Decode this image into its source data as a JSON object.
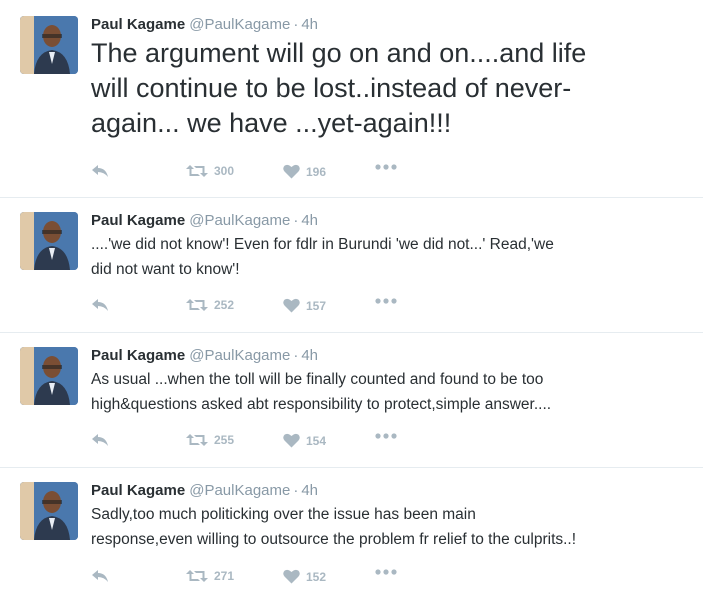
{
  "author": {
    "name": "Paul Kagame",
    "handle": "@PaulKagame",
    "separator": "·"
  },
  "colors": {
    "text": "#292f33",
    "muted": "#8899a6",
    "action": "#aab8c2",
    "divider": "#e6ecf0"
  },
  "tweets": [
    {
      "time": "4h",
      "text_lines": [
        "The argument will go on and on....and life",
        "will continue to be lost..instead of never-",
        "again... we have ...yet-again!!!"
      ],
      "retweets": "300",
      "likes": "196"
    },
    {
      "time": "4h",
      "text_lines": [
        "....'we did not know'!  Even for fdlr in Burundi 'we did not...'  Read,'we",
        "did not want to know'!"
      ],
      "retweets": "252",
      "likes": "157"
    },
    {
      "time": "4h",
      "text_lines": [
        "As usual ...when the toll will be finally counted and found to be too",
        "high&questions asked abt responsibility to protect,simple answer...."
      ],
      "retweets": "255",
      "likes": "154"
    },
    {
      "time": "4h",
      "text_lines": [
        "Sadly,too much politicking over the issue has been main",
        "response,even willing to outsource the problem fr relief to the culprits..!"
      ],
      "retweets": "271",
      "likes": "152"
    }
  ]
}
